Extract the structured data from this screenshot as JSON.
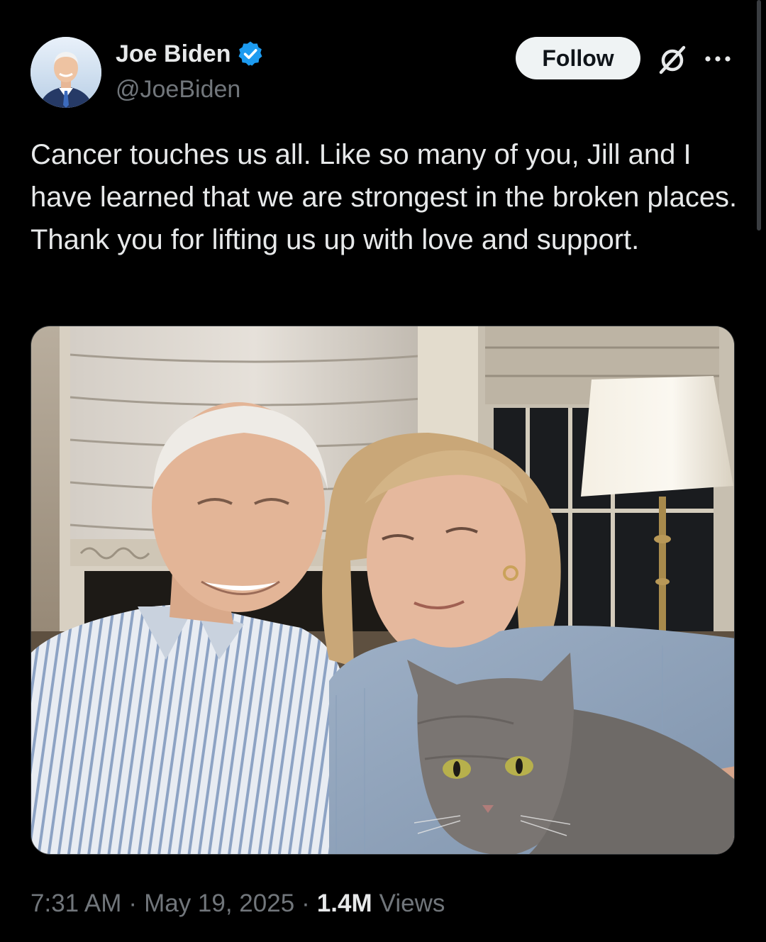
{
  "author": {
    "display_name": "Joe Biden",
    "handle": "@JoeBiden",
    "verified": true,
    "avatar_icon": "profile-photo"
  },
  "actions": {
    "follow_label": "Follow",
    "grok_icon": "grok-icon",
    "more_icon": "more-horizontal-icon"
  },
  "tweet": {
    "text": "Cancer touches us all. Like so many of you, Jill and I have learned that we are strongest in the broken places. Thank you for lifting us up with love and support.",
    "media_alt": "Photo of two people and a gray cat seated in front of a window with a lamp"
  },
  "meta": {
    "time": "7:31 AM",
    "separator": "·",
    "date": "May 19, 2025",
    "views_count": "1.4M",
    "views_label": "Views"
  },
  "colors": {
    "background": "#000000",
    "primary_text": "#e7e9ea",
    "secondary_text": "#71767b",
    "verified_blue": "#1d9bf0",
    "follow_bg": "#eff3f4"
  }
}
